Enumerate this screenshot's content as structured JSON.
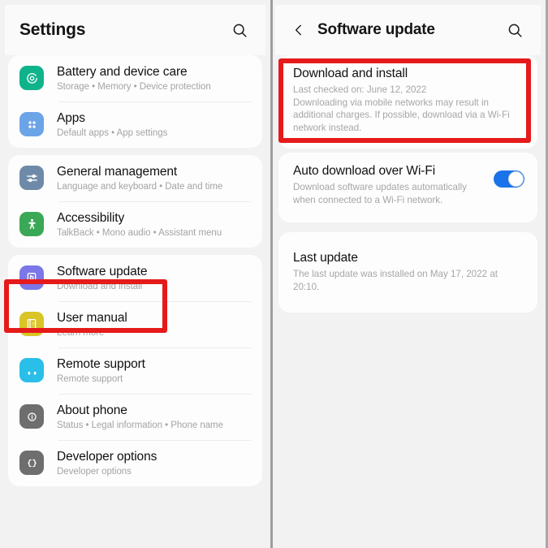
{
  "left_panel": {
    "header": {
      "title": "Settings",
      "search_icon": "search-icon"
    },
    "groups": [
      {
        "items": [
          {
            "title": "Battery and device care",
            "subtitle": "Storage  •  Memory  •  Device protection",
            "icon": "battery-care-icon",
            "icon_color": "#0fb38a"
          },
          {
            "title": "Apps",
            "subtitle": "Default apps  •  App settings",
            "icon": "apps-grid-icon",
            "icon_color": "#6ca4e8"
          }
        ]
      },
      {
        "items": [
          {
            "title": "General management",
            "subtitle": "Language and keyboard  •  Date and time",
            "icon": "sliders-icon",
            "icon_color": "#6e8aa8"
          },
          {
            "title": "Accessibility",
            "subtitle": "TalkBack  •  Mono audio  •  Assistant menu",
            "icon": "accessibility-person-icon",
            "icon_color": "#3aa856"
          }
        ]
      },
      {
        "items": [
          {
            "title": "Software update",
            "subtitle": "Download and install",
            "icon": "software-update-icon",
            "icon_color": "#7b77e8"
          },
          {
            "title": "User manual",
            "subtitle": "Learn more",
            "icon": "manual-book-icon",
            "icon_color": "#d9c527"
          },
          {
            "title": "Remote support",
            "subtitle": "Remote support",
            "icon": "headset-icon",
            "icon_color": "#29bfe8"
          },
          {
            "title": "About phone",
            "subtitle": "Status  •  Legal information  •  Phone name",
            "icon": "info-circle-icon",
            "icon_color": "#6e6e6e"
          },
          {
            "title": "Developer options",
            "subtitle": "Developer options",
            "icon": "code-braces-icon",
            "icon_color": "#6e6e6e"
          }
        ]
      }
    ]
  },
  "right_panel": {
    "header": {
      "title": "Software update",
      "back_icon": "chevron-left-icon",
      "search_icon": "search-icon"
    },
    "sections": [
      {
        "items": [
          {
            "title": "Download and install",
            "subtitle": "Last checked on: June 12, 2022\nDownloading via mobile networks may result in additional charges. If possible, download via a Wi-Fi network instead.",
            "has_toggle": false
          }
        ]
      },
      {
        "items": [
          {
            "title": "Auto download over Wi-Fi",
            "subtitle": "Download software updates automatically when connected to a Wi-Fi network.",
            "has_toggle": true,
            "toggle_on": true
          }
        ]
      },
      {
        "items": [
          {
            "title": "Last update",
            "subtitle": "The last update was installed on May 17, 2022 at 20:10.",
            "has_toggle": false
          }
        ]
      }
    ]
  },
  "annotations": {
    "highlight_color": "#e51a1a",
    "boxes": [
      {
        "name": "software-update-highlight",
        "target": "Software update"
      },
      {
        "name": "download-install-highlight",
        "target": "Download and install"
      }
    ]
  }
}
